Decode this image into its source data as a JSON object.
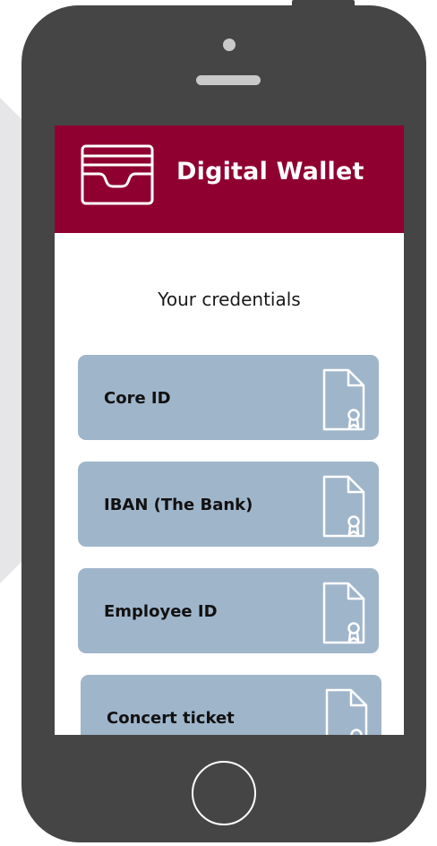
{
  "app": {
    "title": "Digital Wallet",
    "brand_color": "#8f0030"
  },
  "main": {
    "heading": "Your credentials"
  },
  "credentials": [
    {
      "label": "Core ID",
      "icon": "certificate-document-icon"
    },
    {
      "label": "IBAN (The Bank)",
      "icon": "certificate-document-icon"
    },
    {
      "label": "Employee ID",
      "icon": "certificate-document-icon"
    },
    {
      "label": "Concert ticket",
      "icon": "certificate-document-icon"
    }
  ],
  "colors": {
    "card": "#9fb5ca",
    "phone_body": "#454545"
  }
}
